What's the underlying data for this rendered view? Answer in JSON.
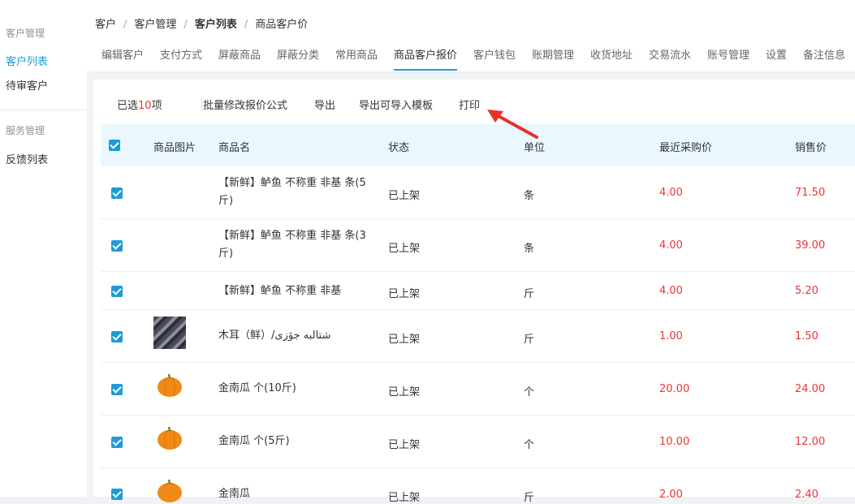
{
  "sidebar": {
    "groups": [
      {
        "title": "客户管理",
        "items": [
          {
            "label": "客户列表",
            "active": true
          },
          {
            "label": "待审客户",
            "active": false
          }
        ]
      },
      {
        "title": "服务管理",
        "items": [
          {
            "label": "反馈列表",
            "active": false
          }
        ]
      }
    ]
  },
  "breadcrumb": [
    "客户",
    "客户管理",
    "客户列表",
    "商品客户价"
  ],
  "tabs": [
    "编辑客户",
    "支付方式",
    "屏蔽商品",
    "屏蔽分类",
    "常用商品",
    "商品客户报价",
    "客户钱包",
    "账期管理",
    "收货地址",
    "交易流水",
    "账号管理",
    "设置",
    "备注信息"
  ],
  "active_tab": "商品客户报价",
  "toolbar": {
    "selected_prefix": "已选",
    "selected_count": "10",
    "selected_suffix": "项",
    "buttons": [
      "批量修改报价公式",
      "导出",
      "导出可导入模板",
      "打印"
    ]
  },
  "table": {
    "headers": [
      "商品图片",
      "商品名",
      "状态",
      "单位",
      "最近采购价",
      "销售价"
    ],
    "rows": [
      {
        "name": "【新鲜】鲈鱼 不称重 非基 条(5斤)",
        "status": "已上架",
        "unit": "条",
        "cost": "4.00",
        "price": "71.50",
        "image": ""
      },
      {
        "name": "【新鲜】鲈鱼 不称重 非基 条(3斤)",
        "status": "已上架",
        "unit": "条",
        "cost": "4.00",
        "price": "39.00",
        "image": ""
      },
      {
        "name": "【新鲜】鲈鱼 不称重 非基",
        "status": "已上架",
        "unit": "斤",
        "cost": "4.00",
        "price": "5.20",
        "image": ""
      },
      {
        "name": "木耳（鲜）/شتالبه جۆزی",
        "status": "已上架",
        "unit": "斤",
        "cost": "1.00",
        "price": "1.50",
        "image": "mushroom-photo"
      },
      {
        "name": "金南瓜 个(10斤)",
        "status": "已上架",
        "unit": "个",
        "cost": "20.00",
        "price": "24.00",
        "image": "pumpkin-photo"
      },
      {
        "name": "金南瓜 个(5斤)",
        "status": "已上架",
        "unit": "个",
        "cost": "10.00",
        "price": "12.00",
        "image": "pumpkin-photo"
      },
      {
        "name": "金南瓜",
        "status": "已上架",
        "unit": "斤",
        "cost": "2.00",
        "price": "2.40",
        "image": "pumpkin-photo"
      }
    ]
  },
  "colors": {
    "accent": "#1d9bd8",
    "price": "#e33333",
    "header_bg": "#eaf8fd",
    "arrow": "#e8302a"
  }
}
